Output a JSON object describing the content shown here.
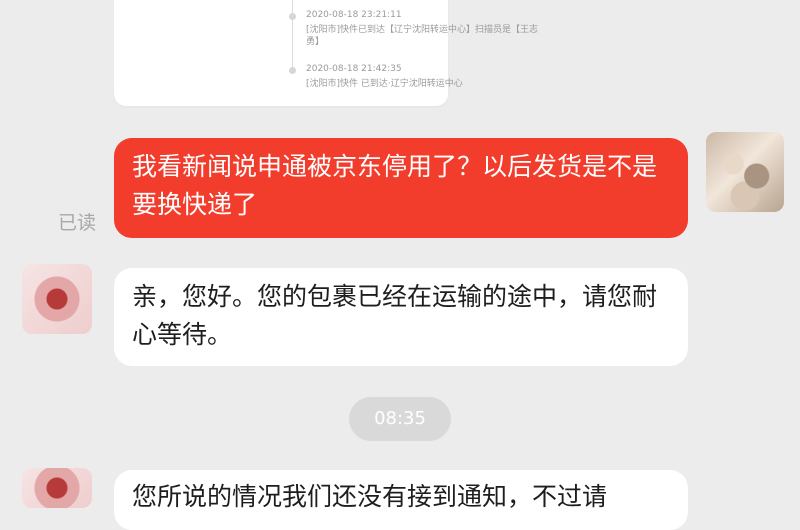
{
  "logistics": {
    "events": [
      {
        "time": "2020-08-18 23:21:11",
        "desc": "[沈阳市]快件已到达【辽宁沈阳转运中心】扫描员是【王志勇】"
      },
      {
        "time": "2020-08-18 21:42:35",
        "desc": "[沈阳市]快件 已到达·辽宁沈阳转运中心"
      }
    ]
  },
  "messages": {
    "outgoing_1": "我看新闻说申通被京东停用了？以后发货是不是要换快递了",
    "read_status": "已读",
    "incoming_1": "亲，您好。您的包裹已经在运输的途中，请您耐心等待。",
    "time_divider": "08:35",
    "incoming_2": "您所说的情况我们还没有接到通知，不过请"
  },
  "colors": {
    "outgoing_bubble": "#f23d2d",
    "incoming_bubble": "#ffffff",
    "background": "#ececec"
  }
}
